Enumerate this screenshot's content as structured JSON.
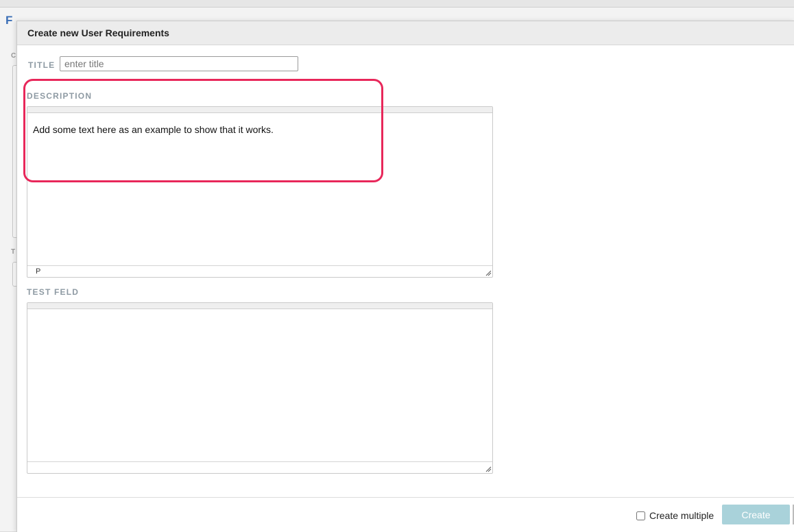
{
  "background": {
    "page_title_key": "F",
    "page_title_rest": "",
    "sidebar_letters": [
      "C",
      "T"
    ]
  },
  "modal": {
    "title": "Create new User Requirements",
    "fields": {
      "title_label": "TITLE",
      "title_placeholder": "enter title",
      "description_label": "DESCRIPTION",
      "description_text": "Add some text here as an example to show that it works.",
      "description_status": "P",
      "test_feld_label": "TEST FELD",
      "test_feld_text": ""
    },
    "footer": {
      "create_multiple_label": "Create multiple",
      "create_button_label": "Create"
    }
  },
  "colors": {
    "highlight": "#e8275a",
    "create_button": "#a9d2da",
    "label": "#8e9aa3"
  }
}
